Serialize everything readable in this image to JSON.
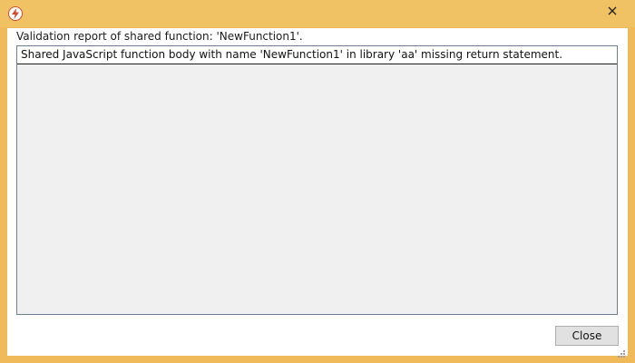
{
  "window": {
    "icon": "flash-icon",
    "close_icon": "close-icon",
    "accent_color": "#f0c263",
    "frame_color": "#f0b95a"
  },
  "dialog": {
    "heading": "Validation report of shared function: 'NewFunction1'.",
    "report_items": [
      "Shared JavaScript function body with name 'NewFunction1' in library 'aa' missing return statement."
    ],
    "close_label": "Close"
  }
}
